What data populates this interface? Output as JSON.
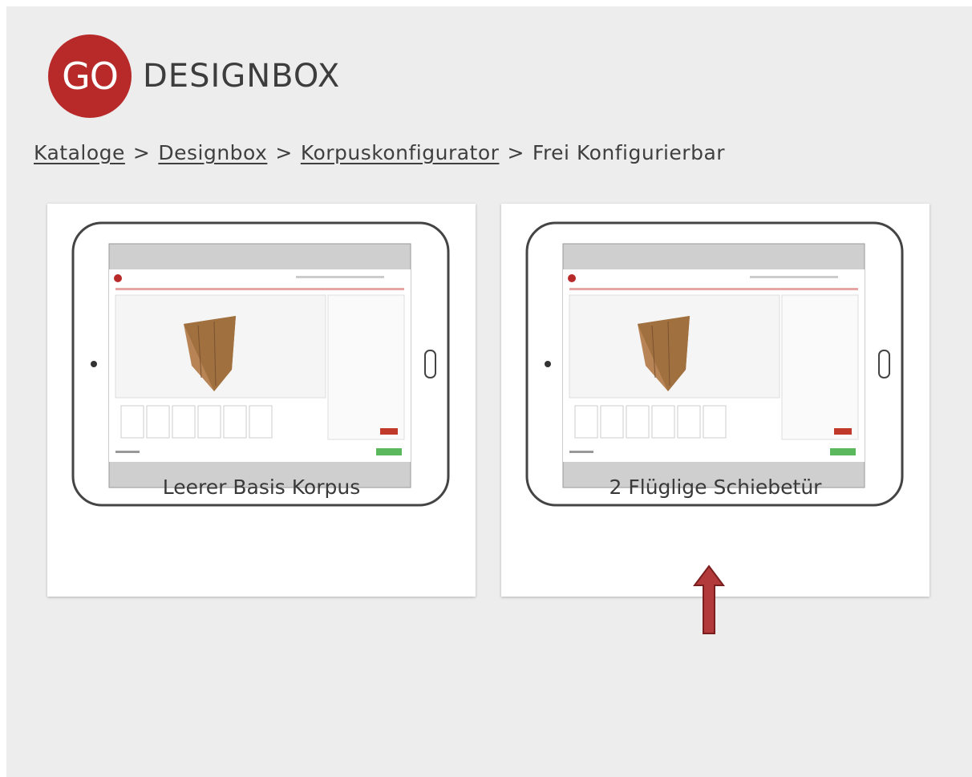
{
  "header": {
    "logo_mark": "GO",
    "brand": "DESIGNBOX",
    "brand_color": "#b82a2a"
  },
  "breadcrumb": {
    "items": [
      "Kataloge",
      "Designbox",
      "Korpuskonfigurator"
    ],
    "current": "Frei Konfigurierbar",
    "separator": ">"
  },
  "cards": [
    {
      "title": "Leerer Basis Korpus",
      "image": "tablet-preview-icon"
    },
    {
      "title": "2 Flüglige Schiebetür",
      "image": "tablet-preview-icon",
      "annotation": "red-arrow-up-icon"
    }
  ]
}
